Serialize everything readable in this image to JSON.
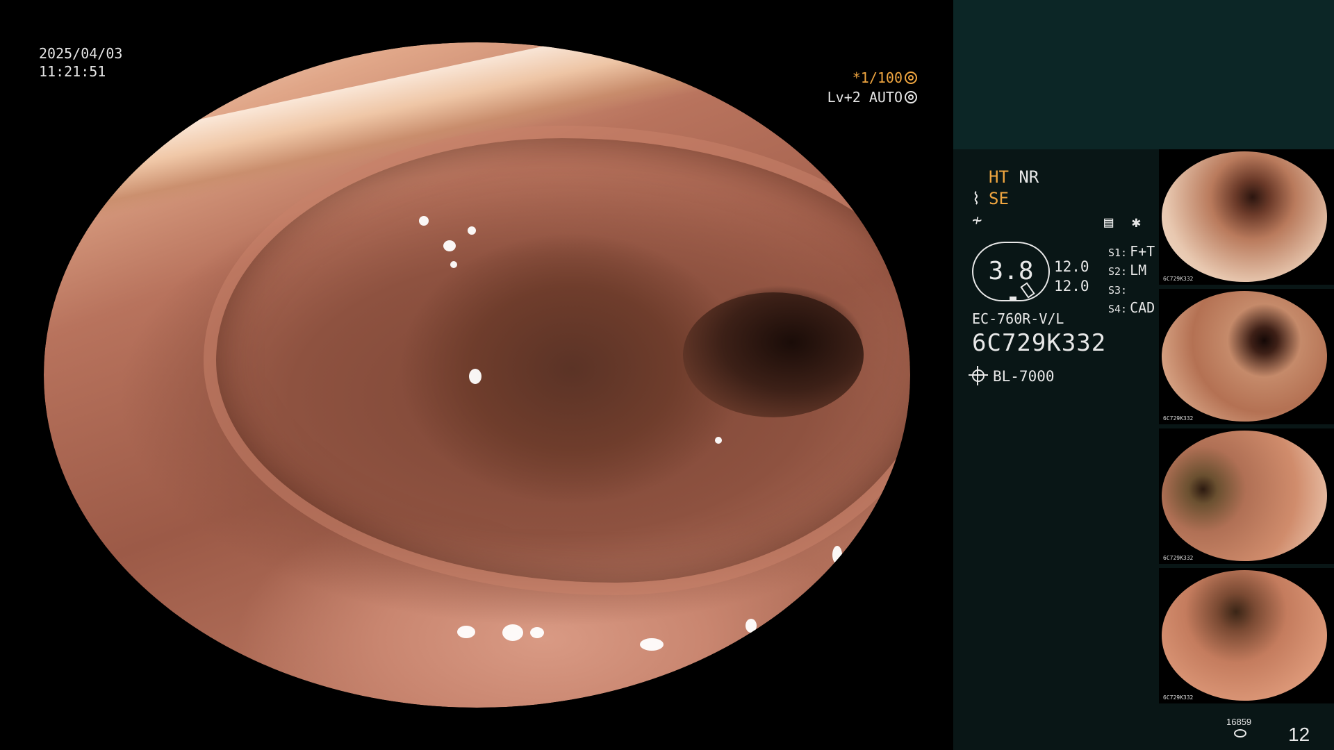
{
  "view": {
    "date": "2025/04/03",
    "time": "11:21:51",
    "shutter": "*1/100",
    "iris": "Lv+2 AUTO"
  },
  "panel": {
    "mode_ht": "HT",
    "mode_nr": "NR",
    "mode_se": "SE",
    "icons": [
      "scope-tip-icon",
      "wave-icon",
      "record-icon",
      "asterisk-icon"
    ],
    "gauge_value": "3.8",
    "values": [
      "12.0",
      "12.0"
    ],
    "slots": [
      {
        "key": "S1:",
        "value": "F+T"
      },
      {
        "key": "S2:",
        "value": "LM"
      },
      {
        "key": "S3:",
        "value": ""
      },
      {
        "key": "S4:",
        "value": "CAD"
      }
    ],
    "scope_model": "EC-760R-V/L",
    "serial": "6C729K332",
    "light_source": "BL-7000",
    "thumbnail_caption": "6C729K332",
    "storage_count": "16859",
    "image_count": "12"
  },
  "colors": {
    "accent_amber": "#f0a640",
    "panel_bg": "#091616",
    "panel_top": "#0c2626",
    "text": "#e8e8e8"
  }
}
